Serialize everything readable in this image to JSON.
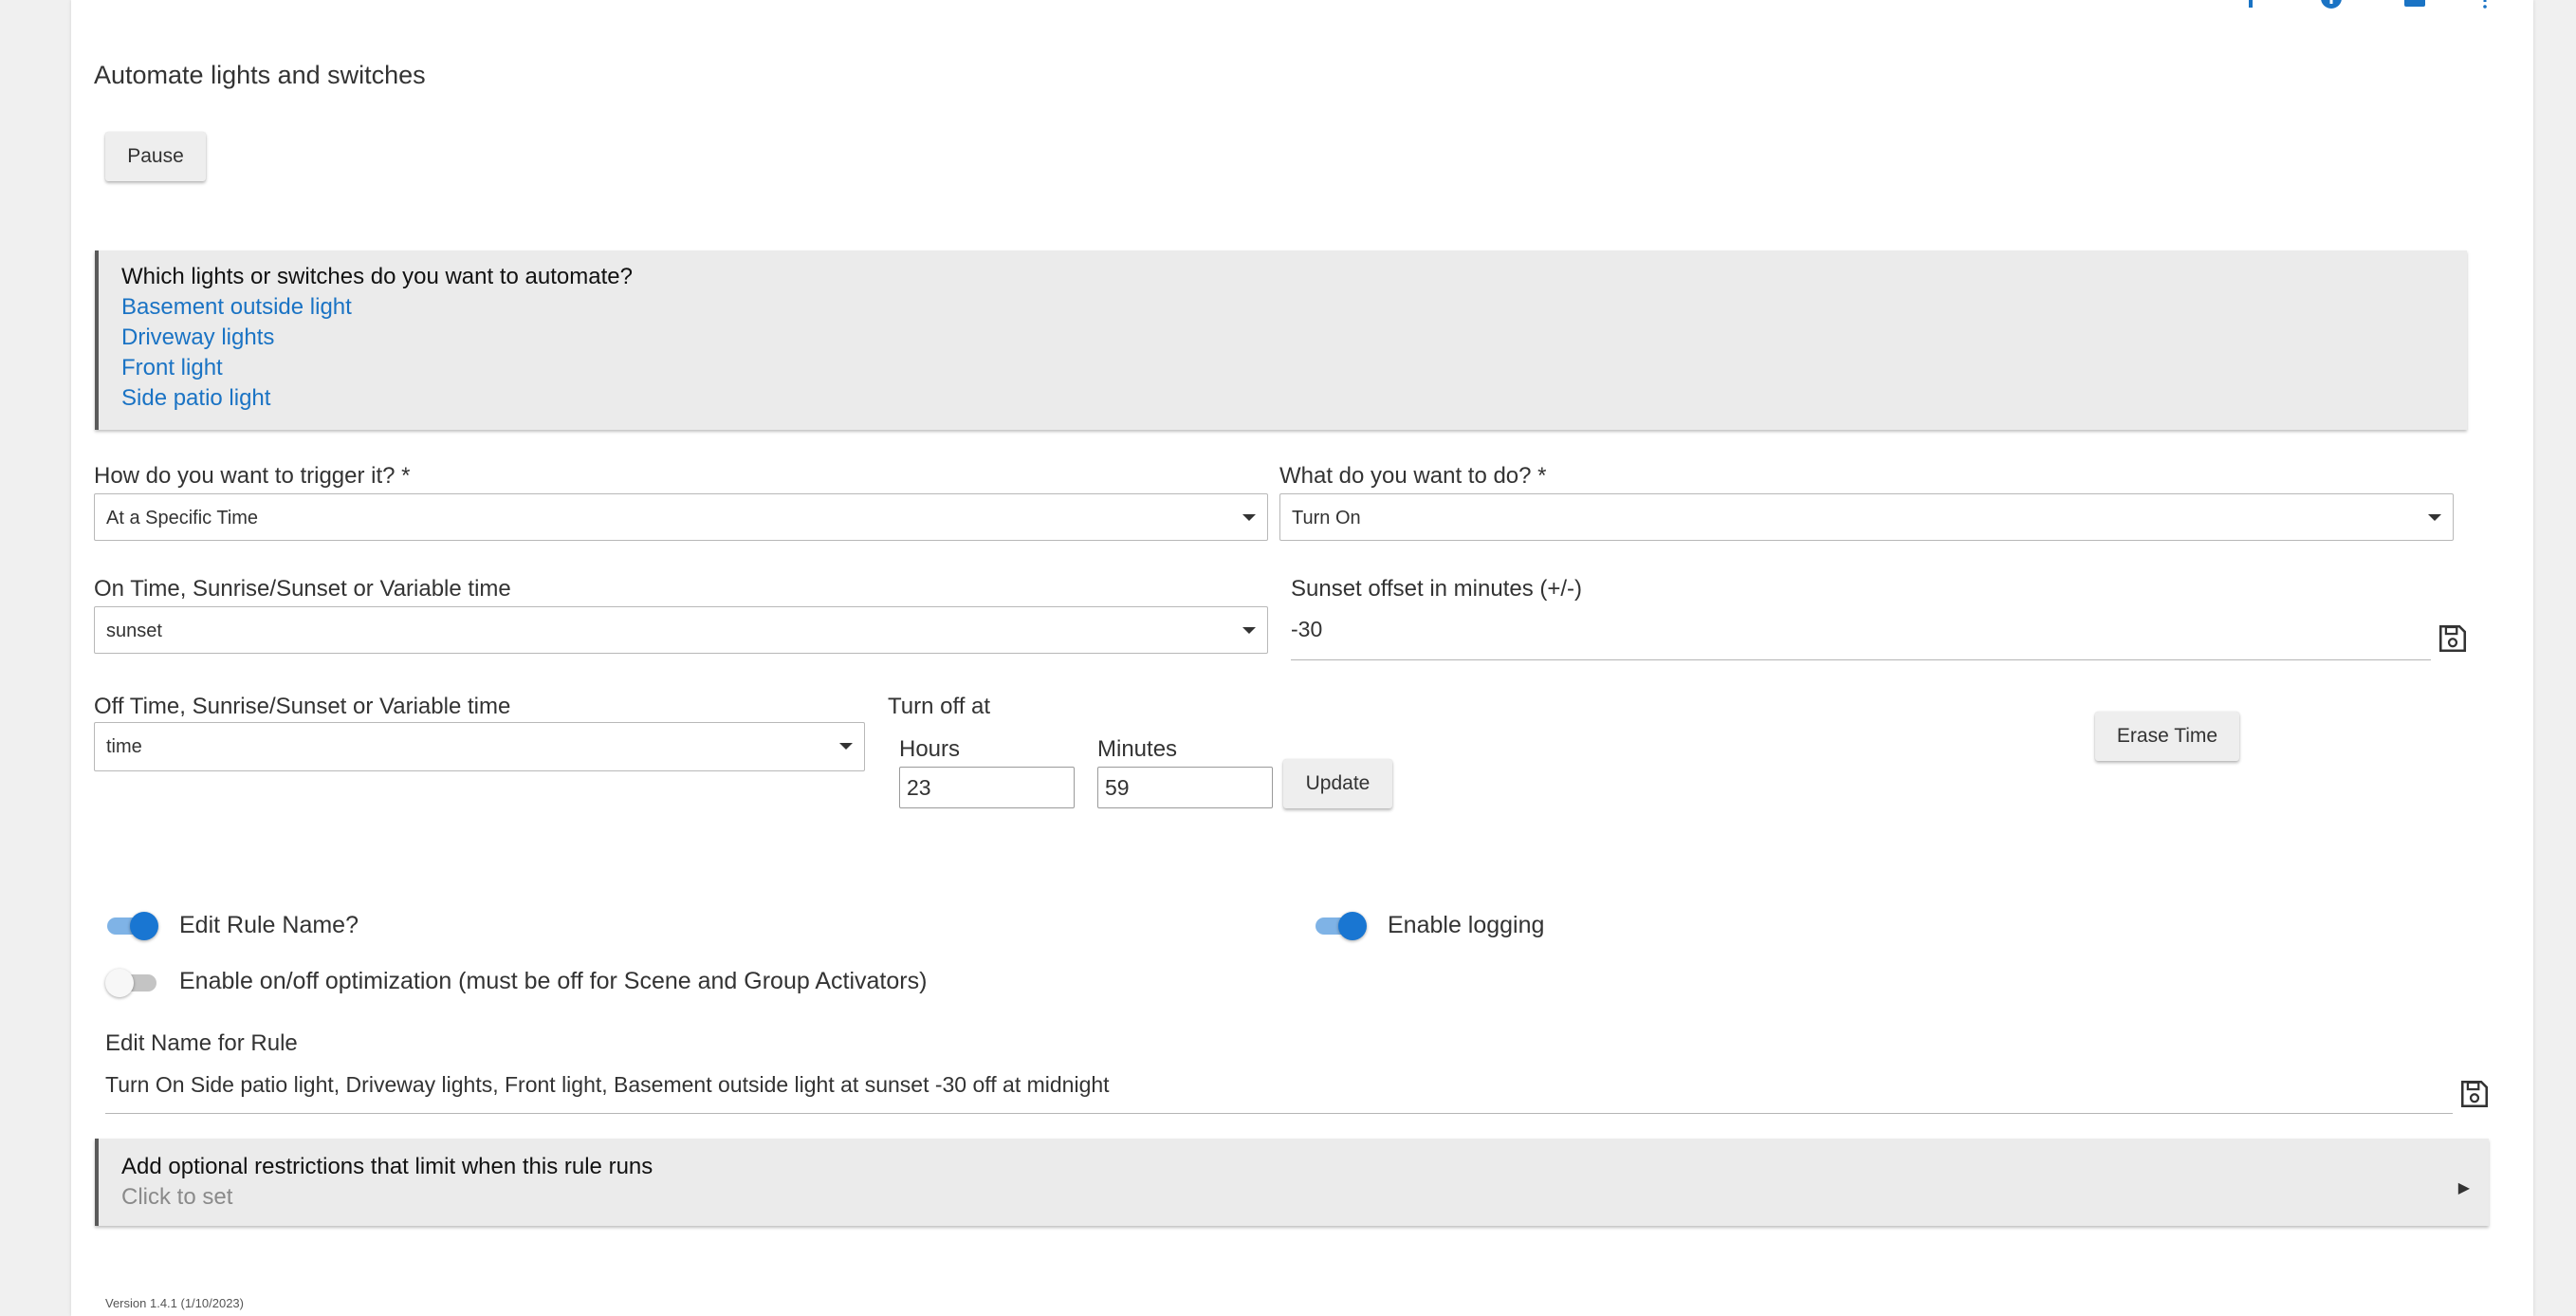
{
  "app": {
    "title": "Automate lights and switches",
    "pause_label": "Pause",
    "version": "Version 1.4.1 (1/10/2023)"
  },
  "toolbar_icons": [
    "add-icon",
    "info-icon",
    "mail-icon",
    "help-icon"
  ],
  "devices_panel": {
    "title": "Which lights or switches do you want to automate?",
    "devices": [
      "Basement outside light",
      "Driveway lights",
      "Front light",
      "Side patio light"
    ]
  },
  "trigger": {
    "label": "How do you want to trigger it? *",
    "value": "At a Specific Time"
  },
  "action": {
    "label": "What do you want to do? *",
    "value": "Turn On"
  },
  "on_time": {
    "label": "On Time, Sunrise/Sunset or Variable time",
    "value": "sunset"
  },
  "sunset_offset": {
    "label": "Sunset offset in minutes (+/-)",
    "value": "-30"
  },
  "off_time": {
    "label": "Off Time, Sunrise/Sunset or Variable time",
    "value": "time"
  },
  "turn_off_at": {
    "label": "Turn off at",
    "hours_label": "Hours",
    "hours_value": "23",
    "minutes_label": "Minutes",
    "minutes_value": "59",
    "update_label": "Update",
    "erase_label": "Erase Time"
  },
  "toggles": {
    "edit_rule_name": {
      "label": "Edit Rule Name?",
      "on": true
    },
    "enable_logging": {
      "label": "Enable logging",
      "on": true
    },
    "optimization": {
      "label": "Enable on/off optimization (must be off for Scene and Group Activators)",
      "on": false
    }
  },
  "rule_name": {
    "label": "Edit Name for Rule",
    "value": "Turn On Side patio light, Driveway lights, Front light, Basement outside light at sunset -30 off at midnight"
  },
  "restrictions": {
    "title": "Add optional restrictions that limit when this rule runs",
    "subtitle": "Click to set"
  },
  "colors": {
    "accent": "#1976d2",
    "link": "#1a73c4",
    "panel_bg": "#ebebeb"
  }
}
